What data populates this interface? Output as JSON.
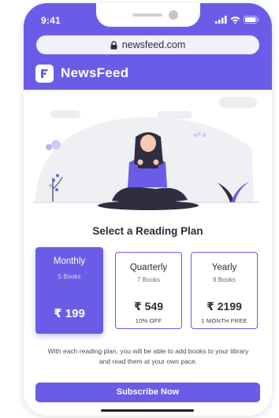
{
  "status_bar": {
    "time": "9:41"
  },
  "browser": {
    "url": "newsfeed.com"
  },
  "app": {
    "name": "NewsFeed",
    "logo_letter": "F"
  },
  "colors": {
    "accent": "#6b5ce7",
    "accent_light": "#f1f0fb",
    "text_dark": "#2d2d3a"
  },
  "icons": {
    "signal": "cellular-signal-icon",
    "wifi": "wifi-icon",
    "battery": "battery-icon",
    "lock": "lock-icon",
    "logo": "newsfeed-logo-icon"
  },
  "section_title": "Select a Reading Plan",
  "plans": [
    {
      "name": "Monthly",
      "books": "5 Books",
      "price": "₹ 199",
      "note": "",
      "selected": true
    },
    {
      "name": "Quarterly",
      "books": "7 Books",
      "price": "₹ 549",
      "note": "10% OFF",
      "selected": false
    },
    {
      "name": "Yearly",
      "books": "9 Books",
      "price": "₹ 2199",
      "note": "1 MONTH FREE",
      "selected": false
    }
  ],
  "description": "With each reading plan, you will be able to add books to your library and read them at your own pace.",
  "cta_label": "Subscribe Now"
}
